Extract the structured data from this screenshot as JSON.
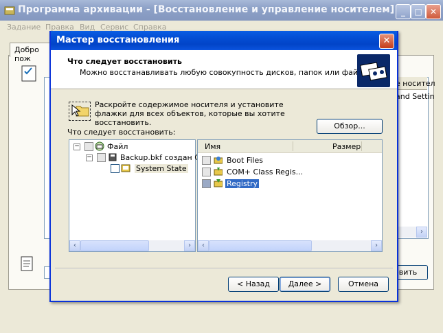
{
  "parent": {
    "title": "Программа архивации - [Восстановление и управление носителем]",
    "menu": [
      "Задание",
      "Правка",
      "Вид",
      "Сервис",
      "Справка"
    ],
    "tab_label": "Добро пож",
    "column_header_fragment": "е носител",
    "cell_fragment": "and Settin",
    "restore_button_fragment": "овить",
    "window_buttons": {
      "minimize": "_",
      "maximize": "□",
      "close": "✕"
    }
  },
  "dialog": {
    "title": "Мастер восстановления",
    "heading": "Что следует восстановить",
    "subheading": "Можно восстанавливать любую совокупность дисков, папок или файлов.",
    "instructions": "Раскройте содержимое носителя и установите флажки для всех объектов, которые вы хотите восстановить.",
    "browse_label": "Обзор...",
    "what_label": "Что следует восстановить:",
    "tree": [
      {
        "label": "Файл",
        "expander": "−",
        "icon": "file-media-icon"
      },
      {
        "label": "Backup.bkf создан С",
        "expander": "−",
        "icon": "backup-icon"
      },
      {
        "label": "System State",
        "icon": "system-state-icon"
      }
    ],
    "list_columns": [
      "Имя",
      "Размер"
    ],
    "list_items": [
      {
        "label": "Boot Files",
        "icon": "boot-files-icon"
      },
      {
        "label": "COM+ Class Regis...",
        "icon": "com-icon"
      },
      {
        "label": "Registry",
        "icon": "registry-icon",
        "selected": true
      }
    ],
    "back_label": "< Назад",
    "next_label": "Далее >",
    "cancel_label": "Отмена",
    "close_glyph": "✕"
  },
  "colors": {
    "titlebar": "#0450d6",
    "selection": "#316ac5",
    "background": "#ece9d8"
  }
}
